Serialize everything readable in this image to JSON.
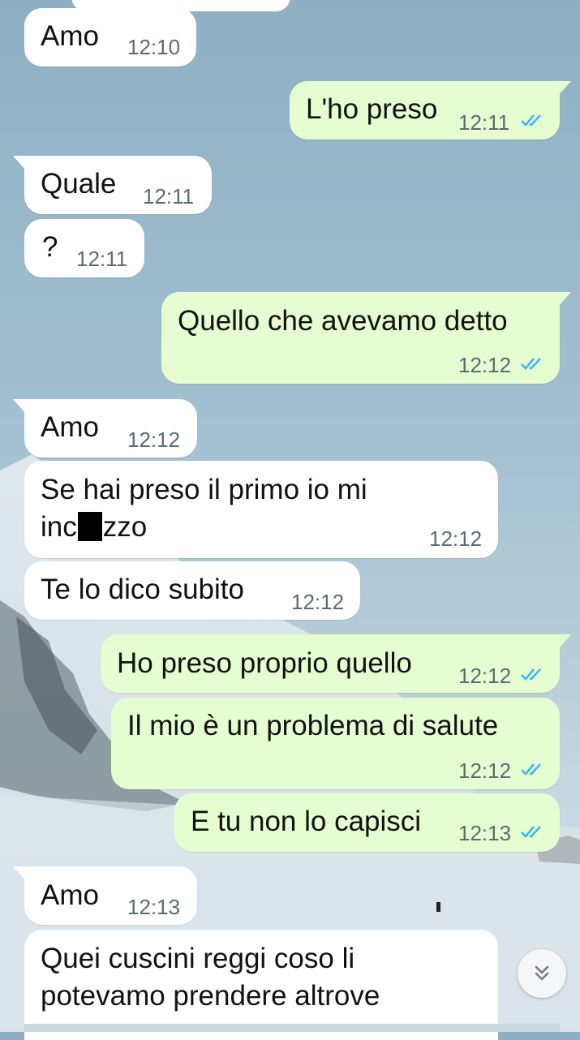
{
  "messages": [
    {
      "text": "Amo",
      "time": "12:10"
    },
    {
      "text": "L'ho preso",
      "time": "12:11"
    },
    {
      "text": "Quale",
      "time": "12:11"
    },
    {
      "text": "?",
      "time": "12:11"
    },
    {
      "text": "Quello che avevamo detto",
      "time": "12:12"
    },
    {
      "text": "Amo",
      "time": "12:12"
    },
    {
      "text_line1": "Se hai preso il primo io mi",
      "text_line2_pre": "inc",
      "text_line2_post": "zzo",
      "time": "12:12"
    },
    {
      "text": "Te lo dico subito",
      "time": "12:12"
    },
    {
      "text": "Ho preso proprio quello",
      "time": "12:12"
    },
    {
      "text": "Il mio è un problema di salute",
      "time": "12:12"
    },
    {
      "text": "E tu non lo capisci",
      "time": "12:13"
    },
    {
      "text": "Amo",
      "time": "12:13"
    },
    {
      "text_line1": "Quei cuscini reggi coso li",
      "text_line2": "potevamo prendere altrove"
    }
  ],
  "colors": {
    "incoming_bubble": "#ffffff",
    "outgoing_bubble": "#e6fdd1",
    "read_ticks": "#34b7f1",
    "timestamp": "#5c6a72"
  },
  "icons": {
    "read_receipt": "double-check-icon",
    "scroll_down": "double-chevron-down-icon"
  }
}
